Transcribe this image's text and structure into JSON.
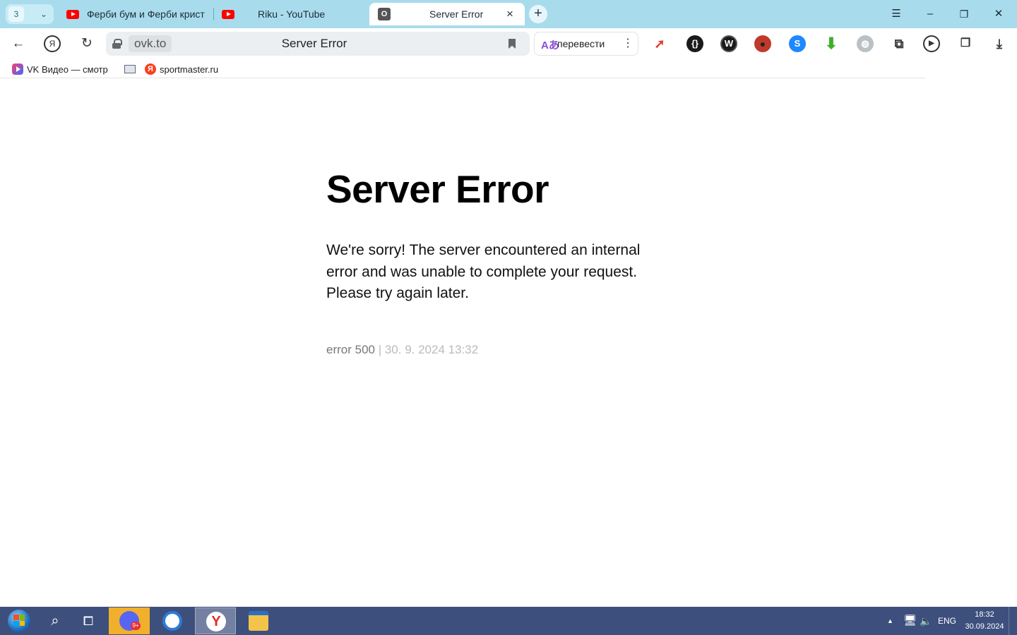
{
  "tabs": {
    "counter": "3",
    "items": [
      {
        "label": "Ферби бум и Ферби крист",
        "icon": "youtube-icon",
        "active": false
      },
      {
        "label": "Riku - YouTube",
        "icon": "youtube-icon",
        "active": false
      },
      {
        "label": "Server Error",
        "icon": "ovk-icon",
        "active": true
      }
    ],
    "close_glyph": "×",
    "new_tab_glyph": "+"
  },
  "window_controls": {
    "menu": "☰",
    "minimize": "–",
    "restore": "❐",
    "close": "✕"
  },
  "address_bar": {
    "domain": "ovk.to",
    "page_title": "Server Error",
    "translate_label": "перевести"
  },
  "bookmarks": [
    {
      "label": "VK Видео — смотр",
      "icon": "vk-video-icon"
    },
    {
      "label": "",
      "icon": "image-icon"
    },
    {
      "label": "sportmaster.ru",
      "icon": "yandex-icon"
    }
  ],
  "page": {
    "heading": "Server Error",
    "message": "We're sorry! The server encountered an internal error and was unable to complete your request. Please try again later.",
    "error_code": "error 500",
    "timestamp": " | 30. 9. 2024 13:32"
  },
  "taskbar": {
    "apps": [
      {
        "name": "discord",
        "badge": "9+"
      },
      {
        "name": "browser-profile"
      },
      {
        "name": "yandex-browser"
      },
      {
        "name": "file-explorer"
      }
    ],
    "language": "ENG",
    "time": "18:32",
    "date": "30.09.2024"
  },
  "colors": {
    "tabstrip": "#a8dced",
    "taskbar": "#3d4f7d",
    "error_code": "#777777",
    "timestamp": "#bbbbbb"
  }
}
